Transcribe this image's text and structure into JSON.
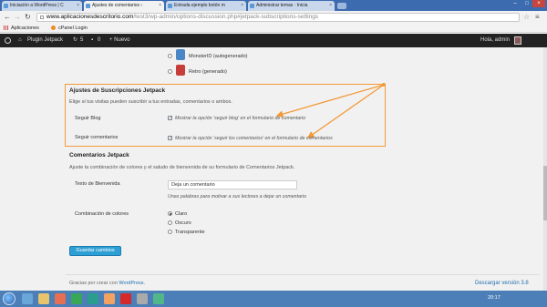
{
  "browser": {
    "tabs": [
      {
        "title": "Iniciación a WordPress | C",
        "active": false
      },
      {
        "title": "Ajustes de comentarios ‹",
        "active": true
      },
      {
        "title": "Entrada ejemplo botón m",
        "active": false
      },
      {
        "title": "Administrar temas · Inicia",
        "active": false
      }
    ],
    "url_host": "www.aplicacionesdescritorio.com",
    "url_path": "/test3/wp-admin/options-discussion.php#jetpack-subscriptions-settings",
    "bookmarks": [
      {
        "label": "Aplicaciones",
        "icon": "apps-grid-icon"
      },
      {
        "label": "cPanel Login",
        "icon": "cpanel-icon"
      }
    ]
  },
  "adminbar": {
    "site_name": "Plugin Jetpack",
    "updates_count": "5",
    "comments_count": "0",
    "new_label": "+ Nuevo",
    "greeting": "Hola, admin"
  },
  "avatars": [
    {
      "label": "MonsterID (autogenerado)"
    },
    {
      "label": "Retro (generado)"
    }
  ],
  "subscriptions": {
    "heading": "Ajustes de Suscripciones Jetpack",
    "description": "Elige si tus visitas pueden suscribir a tus entradas, comentarios o ambos.",
    "blog_label": "Seguir Blog",
    "blog_option": "Mostrar la opción 'seguir blog' en el formulario de comentario",
    "comments_label": "Seguir comentarios",
    "comments_option": "Mostrar la opción 'seguir los comentarios' en el formulario de comentarios"
  },
  "comments": {
    "heading": "Comentarios Jetpack",
    "description": "Ajuste la combinación de colores y el saludo de bienvenida de su formulario de Comentarios Jetpack.",
    "greeting_label": "Texto de Bienvenida",
    "greeting_value": "Deja un comentario",
    "greeting_help": "Unas palabras para motivar a sus lectores a dejar un comentario",
    "color_label": "Combinación de colores",
    "color_options": [
      "Claro",
      "Oscuro",
      "Transparente"
    ],
    "color_selected": "Claro"
  },
  "save_button": "Guardar cambios",
  "footer": {
    "thanks_text": "Gracias por crear con",
    "thanks_link": "WordPress",
    "version": "Descargar versión 3.8"
  },
  "taskbar": {
    "clock": "20:17"
  },
  "colors": {
    "highlight": "#f29a38",
    "adminbar": "#222222",
    "button": "#2e9fd4"
  }
}
